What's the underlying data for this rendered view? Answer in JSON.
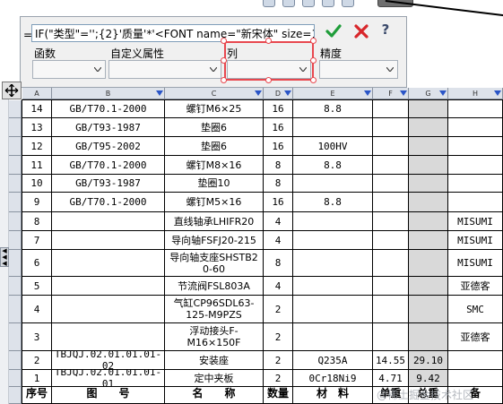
{
  "formula": {
    "eq_sign": "=",
    "value": "IF(\"类型\"='';{2}'质量'*'<FONT name=\"新宋体\" size=12PTS s",
    "fields": [
      {
        "label": "函数",
        "value": ""
      },
      {
        "label": "自定义属性",
        "value": ""
      },
      {
        "label": "列",
        "value": ""
      },
      {
        "label": "精度",
        "value": ""
      }
    ],
    "help_label": "?"
  },
  "columns": [
    "A",
    "B",
    "C",
    "D",
    "E",
    "F",
    "G",
    "H"
  ],
  "rows": [
    {
      "seq": "14",
      "code": "GB/T70.1-2000",
      "name": "螺钉M6×25",
      "qty": "16",
      "material": "8.8",
      "unit": "",
      "total": "",
      "note": ""
    },
    {
      "seq": "13",
      "code": "GB/T93-1987",
      "name": "垫圈6",
      "qty": "16",
      "material": "",
      "unit": "",
      "total": "",
      "note": ""
    },
    {
      "seq": "12",
      "code": "GB/T95-2002",
      "name": "垫圈6",
      "qty": "16",
      "material": "100HV",
      "unit": "",
      "total": "",
      "note": ""
    },
    {
      "seq": "11",
      "code": "GB/T70.1-2000",
      "name": "螺钉M8×16",
      "qty": "8",
      "material": "8.8",
      "unit": "",
      "total": "",
      "note": ""
    },
    {
      "seq": "10",
      "code": "GB/T93-1987",
      "name": "垫圈10",
      "qty": "8",
      "material": "",
      "unit": "",
      "total": "",
      "note": ""
    },
    {
      "seq": "9",
      "code": "GB/T70.1-2000",
      "name": "螺钉M5×16",
      "qty": "16",
      "material": "8.8",
      "unit": "",
      "total": "",
      "note": ""
    },
    {
      "seq": "8",
      "code": "",
      "name": "直线轴承LHIFR20",
      "qty": "4",
      "material": "",
      "unit": "",
      "total": "",
      "note": "MISUMI"
    },
    {
      "seq": "7",
      "code": "",
      "name": "导向轴FSFJ20-215",
      "qty": "4",
      "material": "",
      "unit": "",
      "total": "",
      "note": "MISUMI"
    },
    {
      "seq": "6",
      "code": "",
      "name": "导向轴支座SHSTB2\n0-60",
      "qty": "8",
      "material": "",
      "unit": "",
      "total": "",
      "note": "MISUMI"
    },
    {
      "seq": "5",
      "code": "",
      "name": "节流阀FSL803A",
      "qty": "4",
      "material": "",
      "unit": "",
      "total": "",
      "note": "亚德客"
    },
    {
      "seq": "4",
      "code": "",
      "name": "气缸CP96SDL63-\n125-M9PZS",
      "qty": "2",
      "material": "",
      "unit": "",
      "total": "",
      "note": "SMC"
    },
    {
      "seq": "3",
      "code": "",
      "name": "浮动接头F-\nM16×150F",
      "qty": "2",
      "material": "",
      "unit": "",
      "total": "",
      "note": "亚德客"
    },
    {
      "seq": "2",
      "code": "TBJQJ.02.01.01.01-02",
      "name": "安装座",
      "qty": "2",
      "material": "Q235A",
      "unit": "14.55",
      "total": "29.10",
      "note": ""
    },
    {
      "seq": "1",
      "code": "TBJQJ.02.01.01.01-01",
      "name": "定中夹板",
      "qty": "2",
      "material": "0Cr18Ni9",
      "unit": "4.71",
      "total": "9.42",
      "note": ""
    }
  ],
  "header_row": {
    "seq": "序号",
    "code": "图　　号",
    "name": "名　　称",
    "qty": "数量",
    "material": "材　料",
    "unit": "单重",
    "total": "总重",
    "note": "备"
  },
  "row_markers": [
    "",
    "",
    "",
    "",
    "",
    "",
    "",
    "",
    "",
    "",
    "",
    "",
    "",
    "",
    "",
    "",
    "",
    "",
    "",
    "",
    "",
    "",
    "",
    "",
    "",
    "",
    "",
    "",
    ""
  ],
  "watermark": "@稀土掘金技术社区",
  "colors": {
    "accent_red": "#e8484f",
    "ok_green": "#1f9d3a",
    "cancel_red": "#d8262b",
    "gray_cell": "#d9d9d9"
  }
}
